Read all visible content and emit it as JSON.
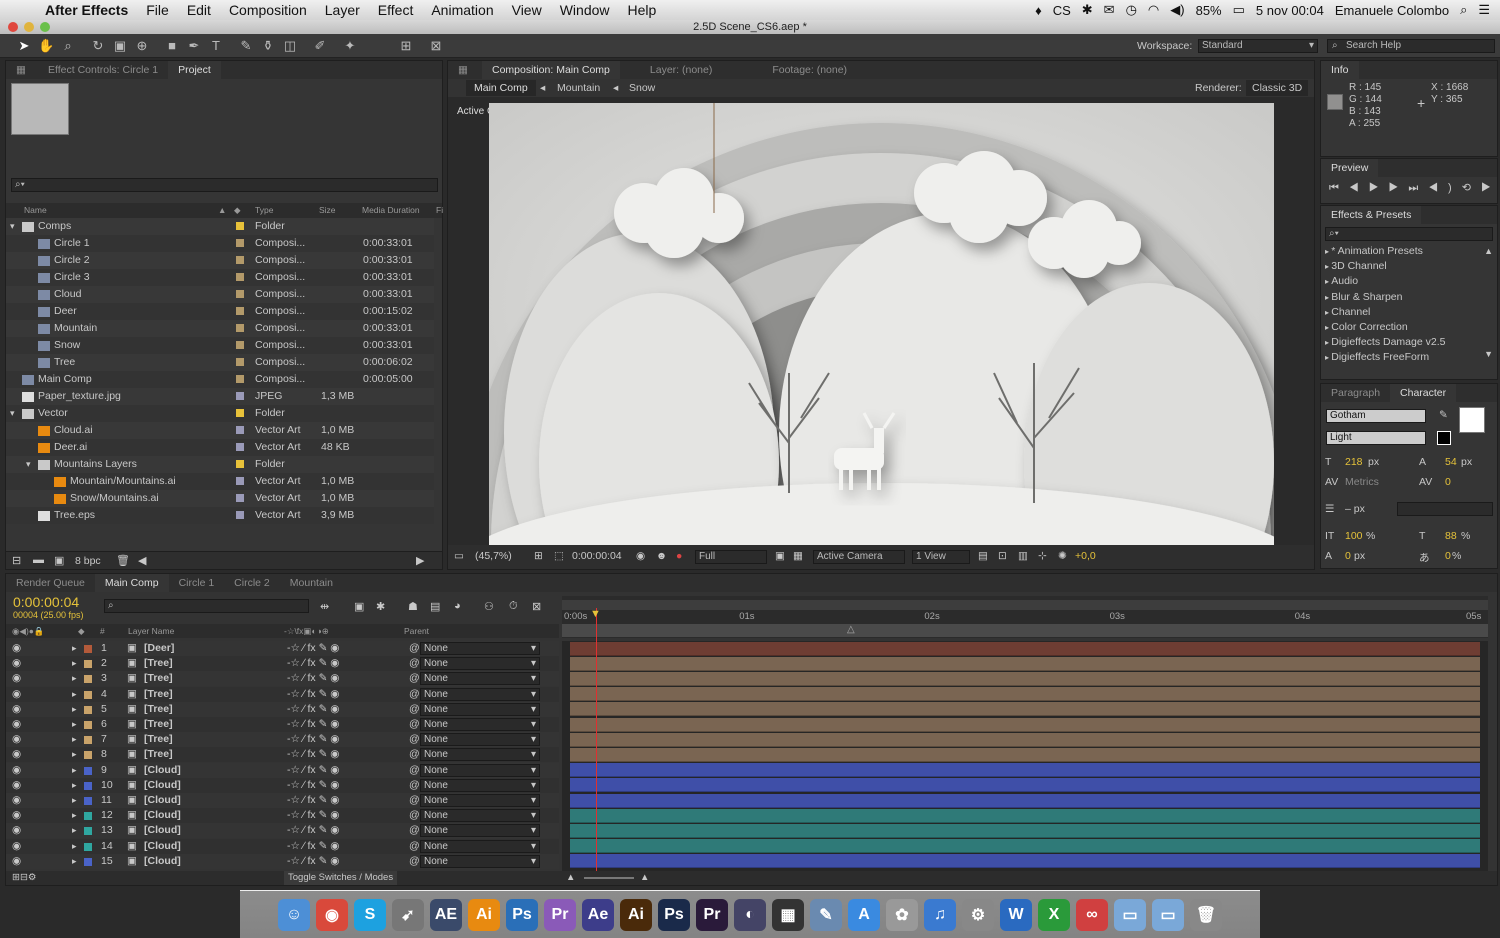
{
  "menubar": {
    "app": "After Effects",
    "items": [
      "File",
      "Edit",
      "Composition",
      "Layer",
      "Effect",
      "Animation",
      "View",
      "Window",
      "Help"
    ],
    "battery": "85%",
    "clock": "5 nov 00:04",
    "user": "Emanuele Colombo",
    "cs_label": "CS"
  },
  "window": {
    "title": "2.5D Scene_CS6.aep *"
  },
  "workspace": {
    "label": "Workspace:",
    "value": "Standard",
    "search_placeholder": "Search Help"
  },
  "project": {
    "tabs": [
      "Effect Controls: Circle 1",
      "Project"
    ],
    "columns": [
      "Name",
      "Type",
      "Size",
      "Media Duration",
      "Fi"
    ],
    "items": [
      {
        "name": "Comps",
        "type": "Folder",
        "size": "",
        "dur": "",
        "indent": 0,
        "kind": "folder",
        "color": "#e8c23a"
      },
      {
        "name": "Circle 1",
        "type": "Composi...",
        "size": "",
        "dur": "0:00:33:01",
        "indent": 1,
        "kind": "comp",
        "color": "#b39a6a"
      },
      {
        "name": "Circle 2",
        "type": "Composi...",
        "size": "",
        "dur": "0:00:33:01",
        "indent": 1,
        "kind": "comp",
        "color": "#b39a6a"
      },
      {
        "name": "Circle 3",
        "type": "Composi...",
        "size": "",
        "dur": "0:00:33:01",
        "indent": 1,
        "kind": "comp",
        "color": "#b39a6a"
      },
      {
        "name": "Cloud",
        "type": "Composi...",
        "size": "",
        "dur": "0:00:33:01",
        "indent": 1,
        "kind": "comp",
        "color": "#b39a6a"
      },
      {
        "name": "Deer",
        "type": "Composi...",
        "size": "",
        "dur": "0:00:15:02",
        "indent": 1,
        "kind": "comp",
        "color": "#b39a6a"
      },
      {
        "name": "Mountain",
        "type": "Composi...",
        "size": "",
        "dur": "0:00:33:01",
        "indent": 1,
        "kind": "comp",
        "color": "#b39a6a"
      },
      {
        "name": "Snow",
        "type": "Composi...",
        "size": "",
        "dur": "0:00:33:01",
        "indent": 1,
        "kind": "comp",
        "color": "#b39a6a"
      },
      {
        "name": "Tree",
        "type": "Composi...",
        "size": "",
        "dur": "0:00:06:02",
        "indent": 1,
        "kind": "comp",
        "color": "#b39a6a"
      },
      {
        "name": "Main Comp",
        "type": "Composi...",
        "size": "",
        "dur": "0:00:05:00",
        "indent": 0,
        "kind": "comp",
        "color": "#b39a6a"
      },
      {
        "name": "Paper_texture.jpg",
        "type": "JPEG",
        "size": "1,3 MB",
        "dur": "",
        "indent": 0,
        "kind": "file",
        "color": "#9a9ab8"
      },
      {
        "name": "Vector",
        "type": "Folder",
        "size": "",
        "dur": "",
        "indent": 0,
        "kind": "folder",
        "color": "#e8c23a"
      },
      {
        "name": "Cloud.ai",
        "type": "Vector Art",
        "size": "1,0 MB",
        "dur": "",
        "indent": 1,
        "kind": "ai",
        "color": "#9a9ab8"
      },
      {
        "name": "Deer.ai",
        "type": "Vector Art",
        "size": "48 KB",
        "dur": "",
        "indent": 1,
        "kind": "ai",
        "color": "#9a9ab8"
      },
      {
        "name": "Mountains Layers",
        "type": "Folder",
        "size": "",
        "dur": "",
        "indent": 1,
        "kind": "folder",
        "color": "#e8c23a"
      },
      {
        "name": "Mountain/Mountains.ai",
        "type": "Vector Art",
        "size": "1,0 MB",
        "dur": "",
        "indent": 2,
        "kind": "ai",
        "color": "#9a9ab8"
      },
      {
        "name": "Snow/Mountains.ai",
        "type": "Vector Art",
        "size": "1,0 MB",
        "dur": "",
        "indent": 2,
        "kind": "ai",
        "color": "#9a9ab8"
      },
      {
        "name": "Tree.eps",
        "type": "Vector Art",
        "size": "3,9 MB",
        "dur": "",
        "indent": 1,
        "kind": "file",
        "color": "#9a9ab8"
      }
    ],
    "bpc": "8 bpc"
  },
  "composition": {
    "tabs": [
      "Composition: Main Comp",
      "Layer: (none)",
      "Footage: (none)"
    ],
    "breadcrumbs": [
      "Main Comp",
      "Mountain",
      "Snow"
    ],
    "renderer_label": "Renderer:",
    "renderer": "Classic 3D",
    "viewer_label": "Active Camera",
    "zoom": "(45,7%)",
    "time": "0:00:00:04",
    "resolution": "Full",
    "camera": "Active Camera",
    "views": "1 View",
    "exposure": "+0,0"
  },
  "info": {
    "title": "Info",
    "r": "R : 145",
    "g": "G : 144",
    "b": "B : 143",
    "a": "A : 255",
    "x": "X : 1668",
    "y": "Y : 365"
  },
  "preview": {
    "title": "Preview"
  },
  "effects": {
    "title": "Effects & Presets",
    "items": [
      "* Animation Presets",
      "3D Channel",
      "Audio",
      "Blur & Sharpen",
      "Channel",
      "Color Correction",
      "Digieffects Damage v2.5",
      "Digieffects FreeForm"
    ]
  },
  "character": {
    "tabs": [
      "Paragraph",
      "Character"
    ],
    "font": "Gotham",
    "style": "Light",
    "size": "218",
    "size_unit": "px",
    "leading": "54",
    "leading_unit": "px",
    "kerning": "Metrics",
    "tracking": "0",
    "stroke": "– px",
    "vscale": "100",
    "hscale": "88",
    "baseline": "0",
    "baseline_unit": "px",
    "tsume": "0",
    "pct": "%"
  },
  "timeline": {
    "tabs": [
      "Render Queue",
      "Main Comp",
      "Circle 1",
      "Circle 2",
      "Mountain"
    ],
    "timecode": "0:00:00:04",
    "fps": "00004 (25.00 fps)",
    "col_layer": "Layer Name",
    "col_parent": "Parent",
    "ruler": [
      "0:00s",
      "01s",
      "02s",
      "03s",
      "04s",
      "05s"
    ],
    "toggle": "Toggle Switches / Modes",
    "layers": [
      {
        "num": "1",
        "name": "[Deer]",
        "parent": "None",
        "color": "#b35a3a",
        "bar": "#6e3d33"
      },
      {
        "num": "2",
        "name": "[Tree]",
        "parent": "None",
        "color": "#c9a36a",
        "bar": "#7a6552"
      },
      {
        "num": "3",
        "name": "[Tree]",
        "parent": "None",
        "color": "#c9a36a",
        "bar": "#7a6552"
      },
      {
        "num": "4",
        "name": "[Tree]",
        "parent": "None",
        "color": "#c9a36a",
        "bar": "#7a6552"
      },
      {
        "num": "5",
        "name": "[Tree]",
        "parent": "None",
        "color": "#c9a36a",
        "bar": "#7a6552"
      },
      {
        "num": "6",
        "name": "[Tree]",
        "parent": "None",
        "color": "#c9a36a",
        "bar": "#7a6552"
      },
      {
        "num": "7",
        "name": "[Tree]",
        "parent": "None",
        "color": "#c9a36a",
        "bar": "#7a6552"
      },
      {
        "num": "8",
        "name": "[Tree]",
        "parent": "None",
        "color": "#c9a36a",
        "bar": "#7a6552"
      },
      {
        "num": "9",
        "name": "[Cloud]",
        "parent": "None",
        "color": "#4a63c8",
        "bar": "#3f4fa8"
      },
      {
        "num": "10",
        "name": "[Cloud]",
        "parent": "None",
        "color": "#4a63c8",
        "bar": "#3f4fa8"
      },
      {
        "num": "11",
        "name": "[Cloud]",
        "parent": "None",
        "color": "#4a63c8",
        "bar": "#3f4fa8"
      },
      {
        "num": "12",
        "name": "[Cloud]",
        "parent": "None",
        "color": "#2fa7a0",
        "bar": "#2f7a78"
      },
      {
        "num": "13",
        "name": "[Cloud]",
        "parent": "None",
        "color": "#2fa7a0",
        "bar": "#2f7a78"
      },
      {
        "num": "14",
        "name": "[Cloud]",
        "parent": "None",
        "color": "#2fa7a0",
        "bar": "#2f7a78"
      },
      {
        "num": "15",
        "name": "[Cloud]",
        "parent": "None",
        "color": "#4a63c8",
        "bar": "#3f4fa8"
      }
    ]
  },
  "dock": {
    "items": [
      {
        "name": "finder-icon",
        "label": "☺",
        "color": "#4d8fd6"
      },
      {
        "name": "chrome-icon",
        "label": "◉",
        "color": "#d9493b"
      },
      {
        "name": "skype-icon",
        "label": "S",
        "color": "#1da1e0"
      },
      {
        "name": "rocket-icon",
        "label": "➹",
        "color": "#777"
      },
      {
        "name": "ae-icon",
        "label": "AE",
        "color": "#3a4a6a"
      },
      {
        "name": "ai-icon",
        "label": "Ai",
        "color": "#e88a10"
      },
      {
        "name": "ps-icon",
        "label": "Ps",
        "color": "#2a6fb8"
      },
      {
        "name": "pr-icon",
        "label": "Pr",
        "color": "#8a5ab8"
      },
      {
        "name": "ae2-icon",
        "label": "Ae",
        "color": "#3d3d8a"
      },
      {
        "name": "ai2-icon",
        "label": "Ai",
        "color": "#4a2a0a"
      },
      {
        "name": "ps2-icon",
        "label": "Ps",
        "color": "#1a2a4a"
      },
      {
        "name": "pr2-icon",
        "label": "Pr",
        "color": "#2a1a3a"
      },
      {
        "name": "quicktime-icon",
        "label": "◐",
        "color": "#446"
      },
      {
        "name": "clapper-icon",
        "label": "▦",
        "color": "#333"
      },
      {
        "name": "preview-icon",
        "label": "✎",
        "color": "#6a8ab0"
      },
      {
        "name": "appstore-icon",
        "label": "A",
        "color": "#3a8ae0"
      },
      {
        "name": "photos-icon",
        "label": "✿",
        "color": "#999"
      },
      {
        "name": "itunes-icon",
        "label": "♫",
        "color": "#3a7ad0"
      },
      {
        "name": "preferences-icon",
        "label": "⚙",
        "color": "#888"
      },
      {
        "name": "word-icon",
        "label": "W",
        "color": "#2a6ac0"
      },
      {
        "name": "excel-icon",
        "label": "X",
        "color": "#2a9a3a"
      },
      {
        "name": "cc-icon",
        "label": "∞",
        "color": "#d04040"
      },
      {
        "name": "folder-icon",
        "label": "▭",
        "color": "#7aa8d8"
      },
      {
        "name": "downloads-icon",
        "label": "▭",
        "color": "#7aa8d8"
      },
      {
        "name": "trash-icon",
        "label": "🗑",
        "color": "#888"
      }
    ]
  }
}
